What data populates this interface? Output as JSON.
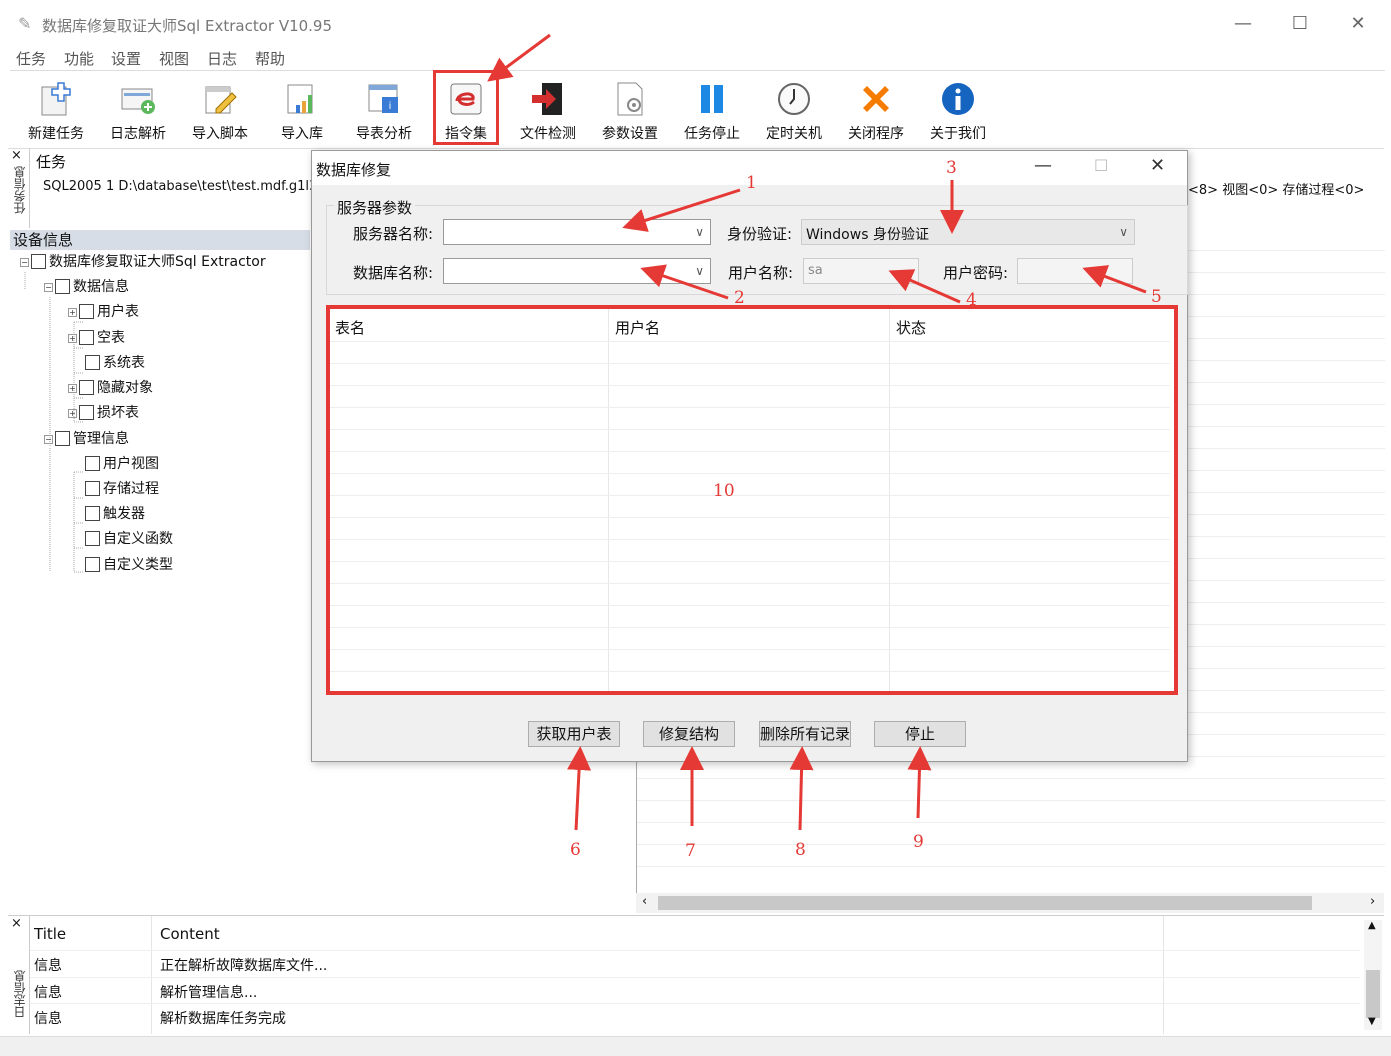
{
  "window": {
    "title": "数据库修复取证大师Sql Extractor V10.95",
    "minimize": "—",
    "maximize": "☐",
    "close": "✕"
  },
  "menu": [
    "任务",
    "功能",
    "设置",
    "视图",
    "日志",
    "帮助"
  ],
  "toolbar": [
    {
      "label": "新建任务",
      "icon": "new-task-icon"
    },
    {
      "label": "日志解析",
      "icon": "log-parse-icon"
    },
    {
      "label": "导入脚本",
      "icon": "import-script-icon"
    },
    {
      "label": "导入库",
      "icon": "import-db-icon"
    },
    {
      "label": "导表分析",
      "icon": "table-analysis-icon"
    },
    {
      "label": "指令集",
      "icon": "command-set-icon"
    },
    {
      "label": "文件检测",
      "icon": "file-check-icon"
    },
    {
      "label": "参数设置",
      "icon": "params-icon"
    },
    {
      "label": "任务停止",
      "icon": "pause-icon"
    },
    {
      "label": "定时关机",
      "icon": "clock-icon"
    },
    {
      "label": "关闭程序",
      "icon": "close-program-icon"
    },
    {
      "label": "关于我们",
      "icon": "info-icon"
    }
  ],
  "task_panel": {
    "side_label": "任务信息",
    "close": "×",
    "header": "任务",
    "row_text": "SQL2005 1 D:\\database\\test\\test.mdf.g1l3u",
    "row_right": "<8> 视图<0> 存储过程<0>"
  },
  "tree": {
    "header": "设备信息",
    "root": "数据库修复取证大师Sql Extractor",
    "data_group": "数据信息",
    "data_items": [
      "用户表",
      "空表",
      "系统表",
      "隐藏对象",
      "损坏表"
    ],
    "mgmt_group": "管理信息",
    "mgmt_items": [
      "用户视图",
      "存储过程",
      "触发器",
      "自定义函数",
      "自定义类型"
    ]
  },
  "dialog": {
    "title": "数据库修复",
    "group": "服务器参数",
    "server_label": "服务器名称:",
    "server_value": "",
    "auth_label": "身份验证:",
    "auth_value": "Windows 身份验证",
    "db_label": "数据库名称:",
    "db_value": "",
    "user_label": "用户名称:",
    "user_value": "sa",
    "pwd_label": "用户密码:",
    "pwd_value": "",
    "columns": [
      "表名",
      "用户名",
      "状态"
    ],
    "buttons": [
      "获取用户表",
      "修复结构",
      "删除所有记录",
      "停止"
    ]
  },
  "annotations": [
    "1",
    "2",
    "3",
    "4",
    "5",
    "6",
    "7",
    "8",
    "9",
    "10"
  ],
  "log": {
    "side_label": "日志信息",
    "close": "×",
    "col_title": "Title",
    "col_content": "Content",
    "rows": [
      {
        "title": "信息",
        "content": "正在解析故障数据库文件..."
      },
      {
        "title": "信息",
        "content": "解析管理信息..."
      },
      {
        "title": "信息",
        "content": "解析数据库任务完成"
      }
    ]
  },
  "colors": {
    "annotation": "#e53935",
    "tree_header": "#d6dde6"
  }
}
